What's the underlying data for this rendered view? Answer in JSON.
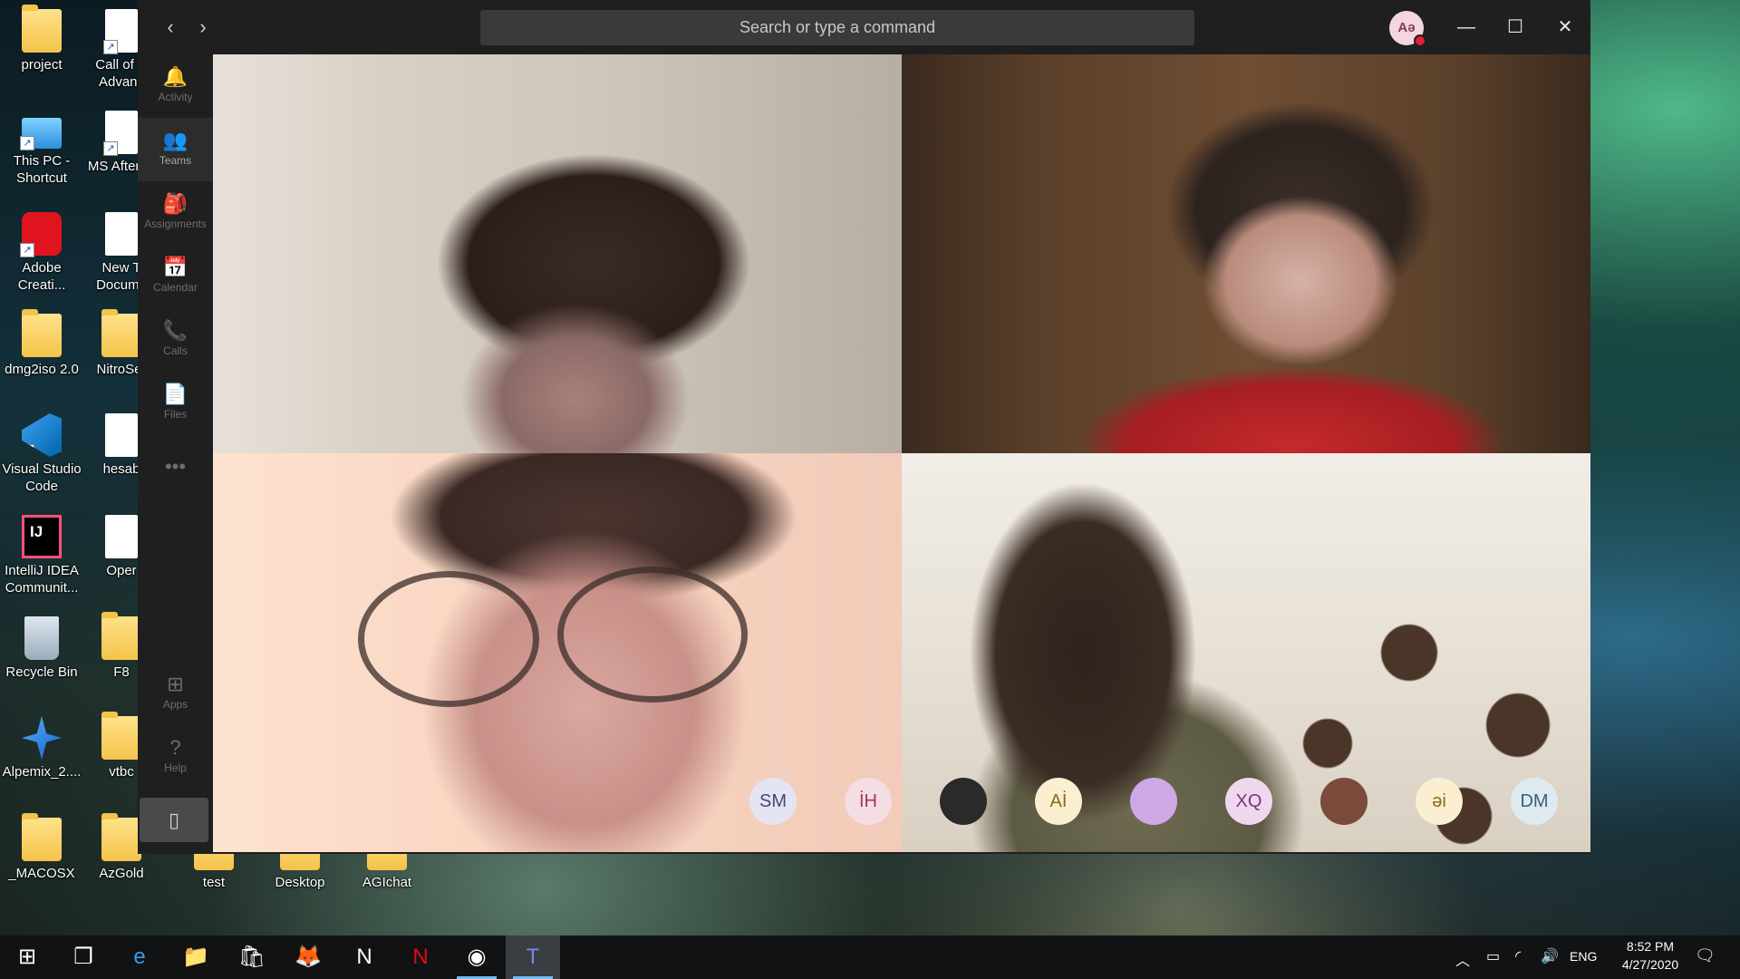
{
  "desktop": {
    "icons_col1": [
      {
        "label": "project",
        "kind": "folder"
      },
      {
        "label": "This PC - Shortcut",
        "kind": "pc"
      },
      {
        "label": "Adobe Creati...",
        "kind": "cc"
      },
      {
        "label": "dmg2iso 2.0",
        "kind": "folder"
      },
      {
        "label": "Visual Studio Code",
        "kind": "vscode"
      },
      {
        "label": "IntelliJ IDEA Communit...",
        "kind": "ij"
      },
      {
        "label": "Recycle Bin",
        "kind": "bin"
      },
      {
        "label": "Alpemix_2....",
        "kind": "alpemix"
      },
      {
        "label": "_MACOSX",
        "kind": "folder"
      }
    ],
    "icons_col2": [
      {
        "label": "Call of D Advanc",
        "kind": "doc"
      },
      {
        "label": "MS Afterbu",
        "kind": "doc"
      },
      {
        "label": "New T Docume",
        "kind": "doc"
      },
      {
        "label": "NitroSer",
        "kind": "folder"
      },
      {
        "label": "hesab",
        "kind": "doc"
      },
      {
        "label": "Oper",
        "kind": "doc"
      },
      {
        "label": "F8",
        "kind": "folder"
      },
      {
        "label": "vtbc",
        "kind": "folder"
      },
      {
        "label": "AzGold",
        "kind": "folder"
      }
    ],
    "icons_bottom": [
      {
        "label": "test"
      },
      {
        "label": "Desktop"
      },
      {
        "label": "AGIchat"
      }
    ]
  },
  "teams": {
    "search_placeholder": "Search or type a command",
    "user_initials": "Aə",
    "rail": [
      {
        "label": "Activity",
        "icon": "bell-icon",
        "glyph": "🔔"
      },
      {
        "label": "Teams",
        "icon": "teams-icon",
        "glyph": "👥"
      },
      {
        "label": "Assignments",
        "icon": "assignments-icon",
        "glyph": "🎒"
      },
      {
        "label": "Calendar",
        "icon": "calendar-icon",
        "glyph": "📅"
      },
      {
        "label": "Calls",
        "icon": "phone-icon",
        "glyph": "📞"
      },
      {
        "label": "Files",
        "icon": "file-icon",
        "glyph": "📄"
      },
      {
        "label": "",
        "icon": "more-icon",
        "glyph": "•••"
      },
      {
        "label": "Apps",
        "icon": "apps-icon",
        "glyph": "⊞"
      },
      {
        "label": "Help",
        "icon": "help-icon",
        "glyph": "?"
      }
    ],
    "roster": [
      {
        "initials": "SM",
        "bg": "#e4e4f2",
        "color": "#464775"
      },
      {
        "initials": "İH",
        "bg": "#f4dde3",
        "color": "#a4375b"
      },
      {
        "initials": "",
        "bg": "#2a2a2a",
        "color": "#ffffff"
      },
      {
        "initials": "Aİ",
        "bg": "#fbefd2",
        "color": "#8a6a14"
      },
      {
        "initials": "",
        "bg": "#cfa8e6",
        "color": "#ffffff"
      },
      {
        "initials": "XQ",
        "bg": "#efd8ee",
        "color": "#7a3576"
      },
      {
        "initials": "",
        "bg": "#7a4a3a",
        "color": "#ffffff"
      },
      {
        "initials": "əi",
        "bg": "#fbefd2",
        "color": "#8a6a14"
      },
      {
        "initials": "DM",
        "bg": "#dfeaf0",
        "color": "#33627a"
      }
    ]
  },
  "taskbar": {
    "apps": [
      {
        "name": "start-icon",
        "glyph": "⊞"
      },
      {
        "name": "task-view-icon",
        "glyph": "❐"
      },
      {
        "name": "edge-icon",
        "glyph": "e"
      },
      {
        "name": "file-explorer-icon",
        "glyph": "📁"
      },
      {
        "name": "store-icon",
        "glyph": "🛍"
      },
      {
        "name": "firefox-icon",
        "glyph": "🦊"
      },
      {
        "name": "n-app-icon",
        "glyph": "N"
      },
      {
        "name": "netflix-icon",
        "glyph": "N"
      },
      {
        "name": "maps-icon",
        "glyph": "◉"
      },
      {
        "name": "teams-taskbar-icon",
        "glyph": "T"
      }
    ],
    "language": "ENG",
    "time": "8:52 PM",
    "date": "4/27/2020"
  }
}
